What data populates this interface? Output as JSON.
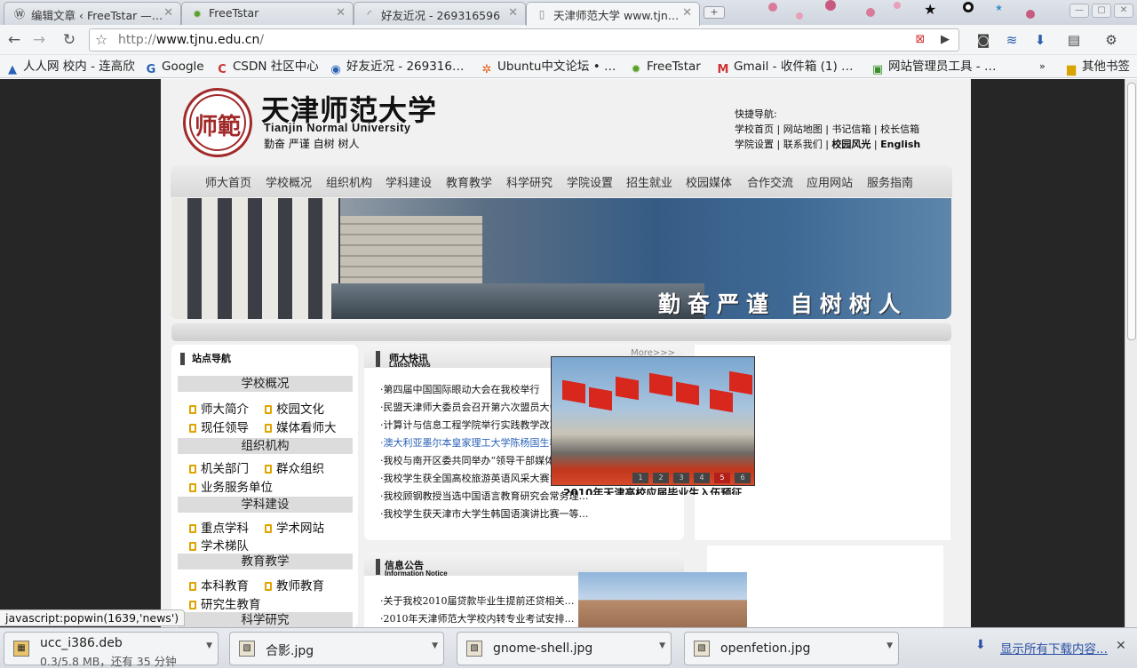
{
  "tabs": [
    {
      "title": "编辑文章 ‹ FreeTstar —…",
      "icon": "wordpress-icon"
    },
    {
      "title": "FreeTstar",
      "icon": "freetstar-icon"
    },
    {
      "title": "好友近况 - 269316596",
      "icon": "loading-spinner-icon"
    },
    {
      "title": "天津师范大学 www.tjn…",
      "icon": "page-icon"
    }
  ],
  "toolbar": {
    "url_prefix": "http://",
    "url_host": "www.tjnu.edu.cn",
    "url_path": "/"
  },
  "bookmarks": [
    {
      "label": "人人网 校内 - 连高欣",
      "icon": "renren-icon"
    },
    {
      "label": "Google",
      "icon": "google-icon"
    },
    {
      "label": "CSDN 社区中心",
      "icon": "csdn-icon"
    },
    {
      "label": "好友近况 - 269316…",
      "icon": "qq-icon"
    },
    {
      "label": "Ubuntu中文论坛 • …",
      "icon": "ubuntu-icon"
    },
    {
      "label": "FreeTstar",
      "icon": "freetstar-icon"
    },
    {
      "label": "Gmail - 收件箱 (1) …",
      "icon": "gmail-icon"
    },
    {
      "label": "网站管理员工具 - …",
      "icon": "webmaster-icon"
    }
  ],
  "other_bookmarks": "其他书签",
  "site": {
    "seal_text": "师範",
    "name_cn": "天津师范大学",
    "name_en": "Tianjin Normal University",
    "motto_small": "勤奋  严谨  自树  树人",
    "quick_title": "快捷导航:",
    "quick_line1": "学校首页 | 网站地图 | 书记信箱 | 校长信箱",
    "quick_line2a": "学院设置 | 联系我们 | ",
    "quick_line2b": "校园风光",
    "quick_line2c": " | ",
    "quick_line2d": "English",
    "mainnav": [
      "师大首页",
      "学校概况",
      "组织机构",
      "学科建设",
      "教育教学",
      "科学研究",
      "学院设置",
      "招生就业",
      "校园媒体",
      "合作交流",
      "应用网站",
      "服务指南"
    ],
    "banner_motto": "勤奋严谨  自树树人"
  },
  "sitenav": {
    "title": "站点导航",
    "sections": [
      {
        "title": "学校概况",
        "links": [
          "师大简介",
          "校园文化",
          "现任领导",
          "媒体看师大"
        ]
      },
      {
        "title": "组织机构",
        "links": [
          "机关部门",
          "群众组织",
          "业务服务单位"
        ]
      },
      {
        "title": "学科建设",
        "links": [
          "重点学科",
          "学术网站",
          "学术梯队"
        ]
      },
      {
        "title": "教育教学",
        "links": [
          "本科教育",
          "教师教育",
          "研究生教育"
        ]
      },
      {
        "title": "科学研究",
        "links": []
      }
    ]
  },
  "news": {
    "title": "师大快讯",
    "subtitle": "Latest News",
    "more": "More>>>",
    "items": [
      "·第四届中国国际眼动大会在我校举行",
      "·民盟天津师大委员会召开第六次盟员大会",
      "·计算计与信息工程学院举行实践教学改革总结…",
      "·澳大利亚墨尔本皇家理工大学陈杨国生教授来…",
      "·我校与南开区委共同举办“领导干部媒体驾驭…",
      "·我校学生获全国高校旅游英语风采大赛“最具…",
      "·我校顾钢教授当选中国语言教育研究会常务理…",
      "·我校学生获天津市大学生韩国语演讲比赛一等…"
    ]
  },
  "notice": {
    "title": "信息公告",
    "subtitle": "Information Notice",
    "items": [
      "·关于我校2010届贷款毕业生提前还贷相关…",
      "·2010年天津师范大学校内转专业考试安排…"
    ]
  },
  "photo": {
    "caption": "2010年天津高校应届毕业生入伍预征",
    "pages": [
      "1",
      "2",
      "3",
      "4",
      "5",
      "6"
    ],
    "active_page": "5"
  },
  "status_text": "javascript:popwin(1639,'news')",
  "downloads": [
    {
      "name": "ucc_i386.deb",
      "progress": "0.3/5.8 MB，还有 35 分钟"
    },
    {
      "name": "合影.jpg",
      "progress": ""
    },
    {
      "name": "gnome-shell.jpg",
      "progress": ""
    },
    {
      "name": "openfetion.jpg",
      "progress": ""
    }
  ],
  "show_all_downloads": "显示所有下载内容..."
}
